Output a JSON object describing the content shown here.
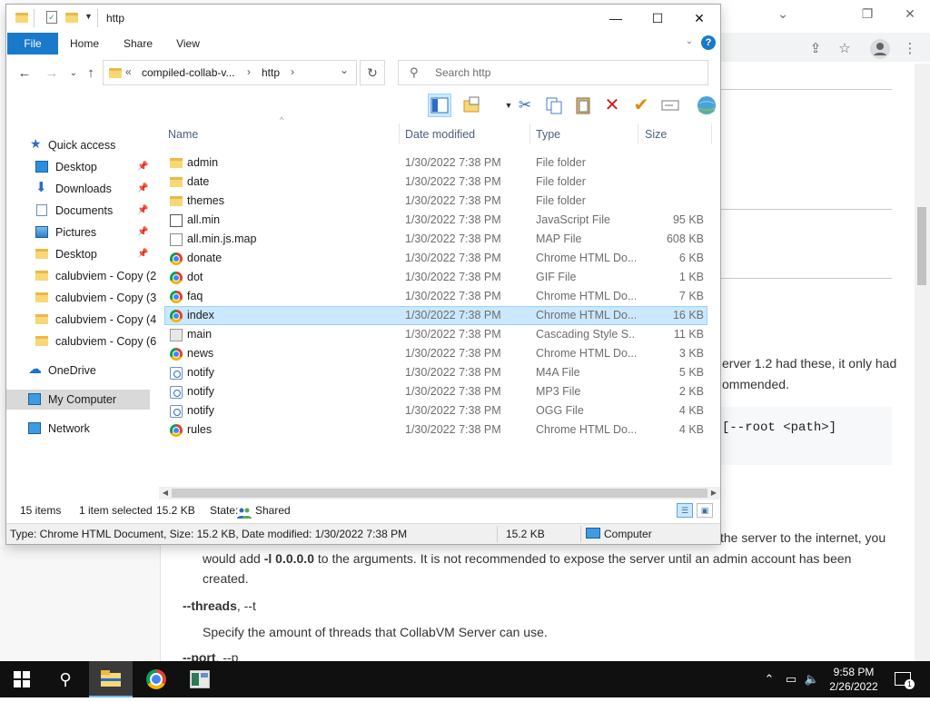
{
  "browser": {
    "window_controls": {
      "minimize": "⌄",
      "restore": "❐",
      "close": "✕"
    },
    "icons": [
      "share-icon",
      "star-icon",
      "profile-icon",
      "menu-icon"
    ],
    "doc": {
      "line1": "erver 1.2 had these, it only had",
      "line2": "ommended.",
      "code": "[--root <path>]",
      "line3": "the server to the internet, you",
      "line4_pre": "would add ",
      "line4_bold": "-l 0.0.0.0",
      "line4_post": " to the arguments. It is not recommended to expose the server until an admin account has been",
      "line5": "created.",
      "opt_threads": "--threads",
      "opt_threads_short": ", --t",
      "threads_desc": "Specify the amount of threads that CollabVM Server can use.",
      "opt_port": "--port",
      "opt_port_short": ", --p"
    }
  },
  "explorer": {
    "title": "http",
    "caption": {
      "minimize": "—",
      "maximize": "☐",
      "close": "✕"
    },
    "ribbon": {
      "file": "File",
      "home": "Home",
      "share": "Share",
      "view": "View",
      "help": "?"
    },
    "address": {
      "prefix": "«",
      "crumb1": "compiled-collab-v...",
      "sep": "›",
      "crumb2": "http",
      "dropdown": "⌄",
      "refresh": "↻"
    },
    "search": {
      "placeholder": "Search http"
    },
    "nav": [
      {
        "label": "Quick access",
        "icon": "star-icon",
        "pinned": false
      },
      {
        "label": "Desktop",
        "icon": "desktop-icon",
        "pinned": true
      },
      {
        "label": "Downloads",
        "icon": "download-icon",
        "pinned": true
      },
      {
        "label": "Documents",
        "icon": "documents-icon",
        "pinned": true
      },
      {
        "label": "Pictures",
        "icon": "pictures-icon",
        "pinned": true
      },
      {
        "label": "Desktop",
        "icon": "folder-icon",
        "pinned": true
      },
      {
        "label": "calubviem - Copy (2",
        "icon": "folder-icon",
        "pinned": false
      },
      {
        "label": "calubviem - Copy (3",
        "icon": "folder-icon",
        "pinned": false
      },
      {
        "label": "calubviem - Copy (4",
        "icon": "folder-icon",
        "pinned": false
      },
      {
        "label": "calubviem - Copy (6",
        "icon": "folder-icon",
        "pinned": false
      },
      {
        "label": "OneDrive",
        "icon": "cloud-icon",
        "pinned": false
      },
      {
        "label": "My Computer",
        "icon": "computer-icon",
        "pinned": false
      },
      {
        "label": "Network",
        "icon": "network-icon",
        "pinned": false
      }
    ],
    "columns": {
      "name": "Name",
      "date": "Date modified",
      "type": "Type",
      "size": "Size"
    },
    "files": [
      {
        "name": "admin",
        "date": "1/30/2022 7:38 PM",
        "type": "File folder",
        "size": "",
        "icon": "folder"
      },
      {
        "name": "date",
        "date": "1/30/2022 7:38 PM",
        "type": "File folder",
        "size": "",
        "icon": "folder"
      },
      {
        "name": "themes",
        "date": "1/30/2022 7:38 PM",
        "type": "File folder",
        "size": "",
        "icon": "folder"
      },
      {
        "name": "all.min",
        "date": "1/30/2022 7:38 PM",
        "type": "JavaScript File",
        "size": "95 KB",
        "icon": "js"
      },
      {
        "name": "all.min.js.map",
        "date": "1/30/2022 7:38 PM",
        "type": "MAP File",
        "size": "608 KB",
        "icon": "doc"
      },
      {
        "name": "donate",
        "date": "1/30/2022 7:38 PM",
        "type": "Chrome HTML Do...",
        "size": "6 KB",
        "icon": "chrome"
      },
      {
        "name": "dot",
        "date": "1/30/2022 7:38 PM",
        "type": "GIF File",
        "size": "1 KB",
        "icon": "chrome"
      },
      {
        "name": "faq",
        "date": "1/30/2022 7:38 PM",
        "type": "Chrome HTML Do...",
        "size": "7 KB",
        "icon": "chrome"
      },
      {
        "name": "index",
        "date": "1/30/2022 7:38 PM",
        "type": "Chrome HTML Do...",
        "size": "16 KB",
        "icon": "chrome",
        "selected": true
      },
      {
        "name": "main",
        "date": "1/30/2022 7:38 PM",
        "type": "Cascading Style S...",
        "size": "11 KB",
        "icon": "css"
      },
      {
        "name": "news",
        "date": "1/30/2022 7:38 PM",
        "type": "Chrome HTML Do...",
        "size": "3 KB",
        "icon": "chrome"
      },
      {
        "name": "notify",
        "date": "1/30/2022 7:38 PM",
        "type": "M4A File",
        "size": "5 KB",
        "icon": "media"
      },
      {
        "name": "notify",
        "date": "1/30/2022 7:38 PM",
        "type": "MP3 File",
        "size": "2 KB",
        "icon": "media"
      },
      {
        "name": "notify",
        "date": "1/30/2022 7:38 PM",
        "type": "OGG File",
        "size": "4 KB",
        "icon": "media"
      },
      {
        "name": "rules",
        "date": "1/30/2022 7:38 PM",
        "type": "Chrome HTML Do...",
        "size": "4 KB",
        "icon": "chrome"
      }
    ],
    "status": {
      "items": "15 items",
      "selected": "1 item selected",
      "selected_size": "15.2 KB",
      "state_label": "State:",
      "state_value": "Shared"
    },
    "status2": {
      "details": "Type: Chrome HTML Document, Size: 15.2 KB, Date modified: 1/30/2022 7:38 PM",
      "size": "15.2 KB",
      "location": "Computer"
    }
  },
  "taskbar": {
    "apps": [
      "start-icon",
      "search-icon",
      "file-explorer-icon",
      "chrome-icon",
      "app-icon"
    ],
    "clock_time": "9:58 PM",
    "clock_date": "2/26/2022",
    "notification_count": "1"
  },
  "colors": {
    "accent": "#1979ca",
    "selection": "#cce8ff",
    "folder": "#f8d775",
    "delete_red": "#d11f1f",
    "check_orange": "#e08a10"
  }
}
